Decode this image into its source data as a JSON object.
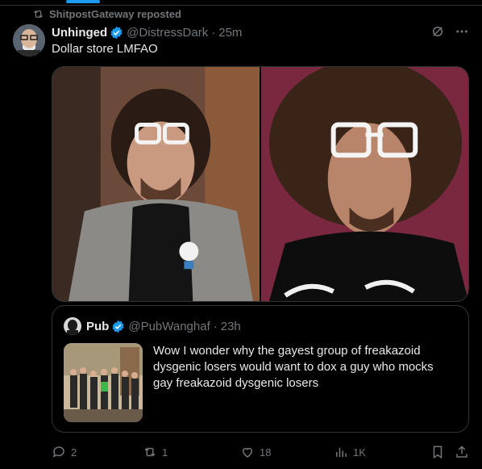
{
  "repost": {
    "label": "ShitpostGateway reposted"
  },
  "tweet": {
    "display_name": "Unhinged",
    "handle": "@DistressDark",
    "separator": "·",
    "time": "25m",
    "text": "Dollar store LMFAO"
  },
  "quote": {
    "display_name": "Pub",
    "handle": "@PubWanghaf",
    "separator": "·",
    "time": "23h",
    "text": "Wow I wonder why the gayest group of freakazoid dysgenic losers would want to dox a guy who mocks gay freakazoid dysgenic losers"
  },
  "actions": {
    "replies": "2",
    "reposts": "1",
    "likes": "18",
    "views": "1K"
  },
  "colors": {
    "accent": "#1d9bf0",
    "muted": "#71767b",
    "text": "#e7e9ea",
    "border": "#2f3336",
    "background": "#000000"
  },
  "icons": [
    "repost-icon",
    "verified-badge-icon",
    "grok-icon",
    "more-icon",
    "reply-icon",
    "like-icon",
    "views-icon",
    "bookmark-icon",
    "share-icon"
  ]
}
